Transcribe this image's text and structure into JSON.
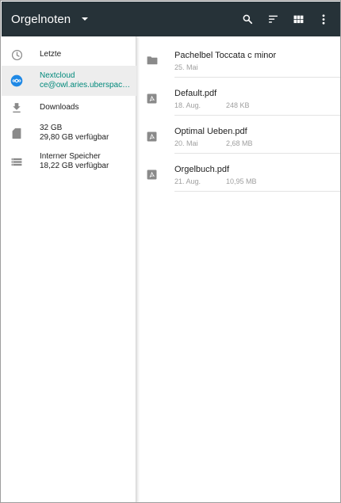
{
  "toolbar": {
    "title": "Orgelnoten",
    "actions": [
      "search-icon",
      "sort-icon",
      "grid-view-icon",
      "more-vert-icon"
    ]
  },
  "drawer": {
    "roots": [
      {
        "icon": "clock-icon",
        "line1": "Letzte",
        "line2": ""
      },
      {
        "icon": "nextcloud-icon",
        "line1": "Nextcloud",
        "line2": "ce@owl.aries.uberspace....",
        "active": true
      },
      {
        "icon": "download-icon",
        "line1": "Downloads",
        "line2": ""
      },
      {
        "icon": "sd-card-icon",
        "line1": "32 GB",
        "line2": "29,80 GB verfügbar"
      },
      {
        "icon": "storage-icon",
        "line1": "Interner Speicher",
        "line2": "18,22 GB verfügbar"
      }
    ]
  },
  "files": [
    {
      "icon": "folder-icon",
      "name": "Pachelbel Toccata c minor",
      "date": "25. Mai",
      "size": ""
    },
    {
      "icon": "pdf-icon",
      "name": "Default.pdf",
      "date": "18. Aug.",
      "size": "248 KB"
    },
    {
      "icon": "pdf-icon",
      "name": "Optimal Ueben.pdf",
      "date": "20. Mai",
      "size": "2,68 MB"
    },
    {
      "icon": "pdf-icon",
      "name": "Orgelbuch.pdf",
      "date": "21. Aug.",
      "size": "10,95 MB"
    }
  ],
  "colors": {
    "toolbar": "#263238",
    "accent": "#00897b",
    "selected_bg": "#ededed"
  }
}
